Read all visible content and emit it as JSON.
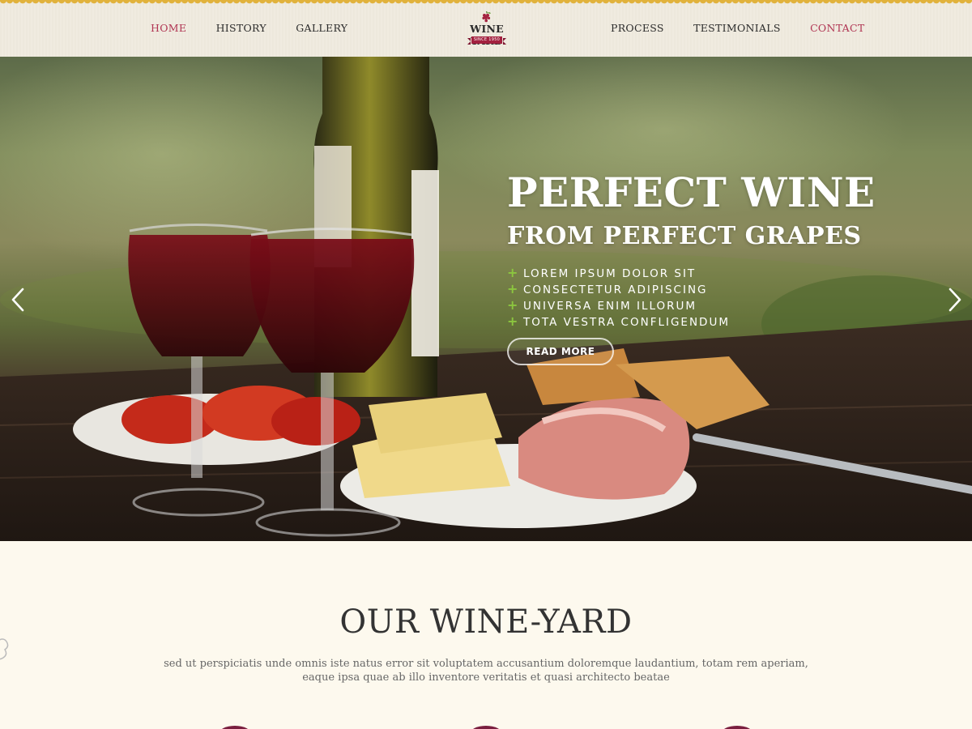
{
  "nav": {
    "left": [
      {
        "label": "HOME",
        "active": true
      },
      {
        "label": "HISTORY",
        "active": false
      },
      {
        "label": "GALLERY",
        "active": false
      }
    ],
    "right": [
      {
        "label": "PROCESS",
        "active": false
      },
      {
        "label": "TESTIMONIALS",
        "active": false
      },
      {
        "label": "CONTACT",
        "active": true
      }
    ]
  },
  "logo": {
    "text": "WINE YARD",
    "tagline": "SINCE 1950"
  },
  "hero": {
    "title": "PERFECT WINE",
    "subtitle": "FROM PERFECT GRAPES",
    "features": [
      "LOREM IPSUM DOLOR SIT",
      "CONSECTETUR ADIPISCING",
      "UNIVERSA ENIM ILLORUM",
      "TOTA VESTRA CONFLIGENDUM"
    ],
    "cta_label": "READ MORE"
  },
  "section": {
    "title": "OUR WINE-YARD",
    "text_line1": "sed ut perspiciatis unde omnis iste natus error sit voluptatem accusantium doloremque laudantium, totam rem aperiam,",
    "text_line2": "eaque ipsa quae ab illo inventore veritatis et quasi architecto beatae"
  },
  "colors": {
    "accent": "#b03553",
    "header_bg": "#f0ebdf",
    "page_bg": "#fdf9ee",
    "trim": "#e1b23c",
    "bullet": "#8cc63f"
  },
  "icons": {
    "prev": "chevron-left-icon",
    "next": "chevron-right-icon",
    "logo": "grape-icon",
    "bullet": "plus-icon"
  }
}
